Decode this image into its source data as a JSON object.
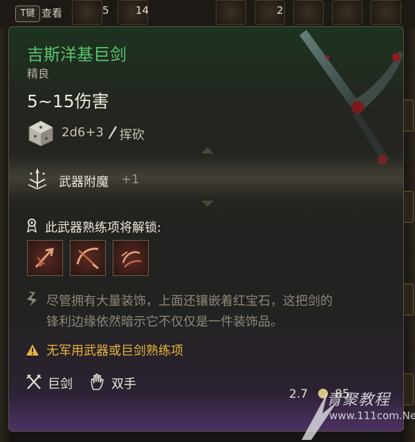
{
  "background": {
    "inspect_key": "T键",
    "inspect_label": "查看",
    "inventory_counts": [
      "5",
      "14",
      "2"
    ]
  },
  "tooltip": {
    "name": "吉斯洋基巨剑",
    "rarity": "精良",
    "damage": "5~15伤害",
    "damage_dice": "2d6+3",
    "damage_type": "挥砍",
    "enchantment_label": "武器附魔",
    "enchantment_value": "+1",
    "proficiency_unlock_label": "此武器熟练项将解锁:",
    "weapon_actions": [
      "weapon-action-1",
      "weapon-action-2",
      "weapon-action-3"
    ],
    "description_line1": "尽管拥有大量装饰，上面还镶嵌着红宝石，这把剑的",
    "description_line2": "锋利边缘依然暗示它不仅仅是一件装饰品。",
    "warning": "无军用武器或巨剑熟练项",
    "tags": [
      {
        "icon": "crossed-swords-icon",
        "label": "巨剑"
      },
      {
        "icon": "open-hand-icon",
        "label": "双手"
      }
    ],
    "price": "2.7",
    "weight": "85"
  },
  "watermark": {
    "name": "青聚教程",
    "url": "www.111com.Net"
  },
  "colors": {
    "item_name": "#58c46c",
    "warning": "#e7b43c",
    "description": "#8e877a",
    "panel_border": "#5a5544"
  }
}
